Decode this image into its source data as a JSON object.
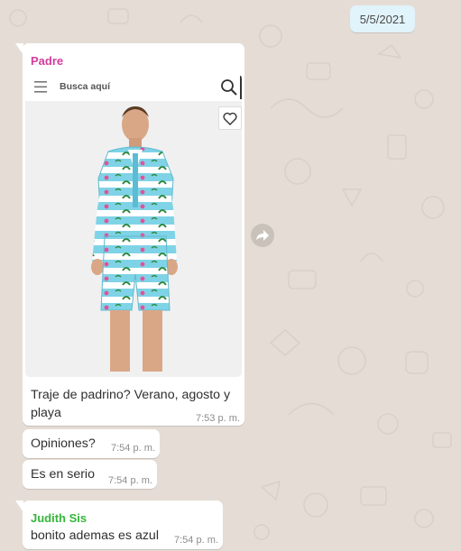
{
  "date_chip": "5/5/2021",
  "messages": [
    {
      "sender": "Padre",
      "sender_color": "#d33c9b",
      "search": {
        "placeholder": "Busca aquí"
      },
      "text": "Traje de padrino? Verano, agosto y playa",
      "time": "7:53 p. m."
    },
    {
      "text": "Opiniones?",
      "time": "7:54 p. m."
    },
    {
      "text": "Es en serio",
      "time": "7:54 p. m."
    },
    {
      "sender": "Judith Sis",
      "sender_color": "#35b53a",
      "text": "bonito ademas es azul",
      "time": "7:54 p. m."
    }
  ],
  "icons": [
    "menu-icon",
    "search-icon",
    "heart-icon",
    "forward-icon"
  ],
  "colors": {
    "chat_background": "#e5ddd5",
    "bubble": "#ffffff",
    "date_chip": "#e1f3fb",
    "timestamp": "#8c8c8c"
  }
}
